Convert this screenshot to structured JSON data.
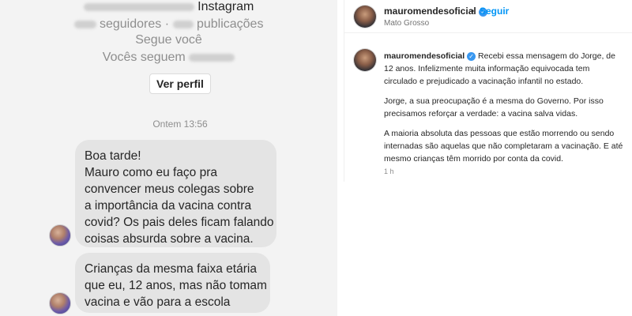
{
  "dm": {
    "profile": {
      "platform": "Instagram",
      "followers_label": "seguidores",
      "posts_label": "publicações",
      "follows_you": "Segue você",
      "you_follow_prefix": "Vocês seguem"
    },
    "view_profile_button": "Ver perfil",
    "timestamp": "Ontem 13:56",
    "messages": [
      {
        "lines": [
          "Boa tarde!",
          "Mauro como eu faço pra",
          "convencer meus colegas sobre",
          "a importância da vacina contra",
          "covid? Os pais deles ficam falando",
          "coisas absurda sobre a vacina."
        ]
      },
      {
        "lines": [
          "Crianças da mesma faixa etária",
          "que eu, 12 anos, mas não tomam",
          "vacina e vão para a escola"
        ]
      }
    ]
  },
  "post": {
    "username": "mauromendesoficial",
    "separator": "•",
    "follow_label": "Seguir",
    "location": "Mato Grosso",
    "caption": {
      "username": "mauromendesoficial",
      "paragraphs": [
        "Recebi essa mensagem do Jorge, de 12 anos. Infelizmente muita informação equivocada tem circulado e prejudicado a vacinação infantil no estado.",
        "Jorge, a sua preocupação é a mesma do Governo. Por isso precisamos reforçar a verdade: a vacina salva vidas.",
        "A maioria absoluta das pessoas que estão morrendo ou sendo internadas são aquelas que não completaram a vacinação. E até mesmo crianças têm morrido por conta da covid."
      ]
    },
    "time_ago": "1 h"
  },
  "colors": {
    "dm_background": "#f3f3f3",
    "bubble": "#e4e4e4",
    "link_blue": "#0095f6",
    "verified_blue": "#3897f0",
    "muted_text": "#8e8e8e"
  },
  "icons": {
    "verified": "verified-badge-icon",
    "check": "checkmark-icon"
  }
}
